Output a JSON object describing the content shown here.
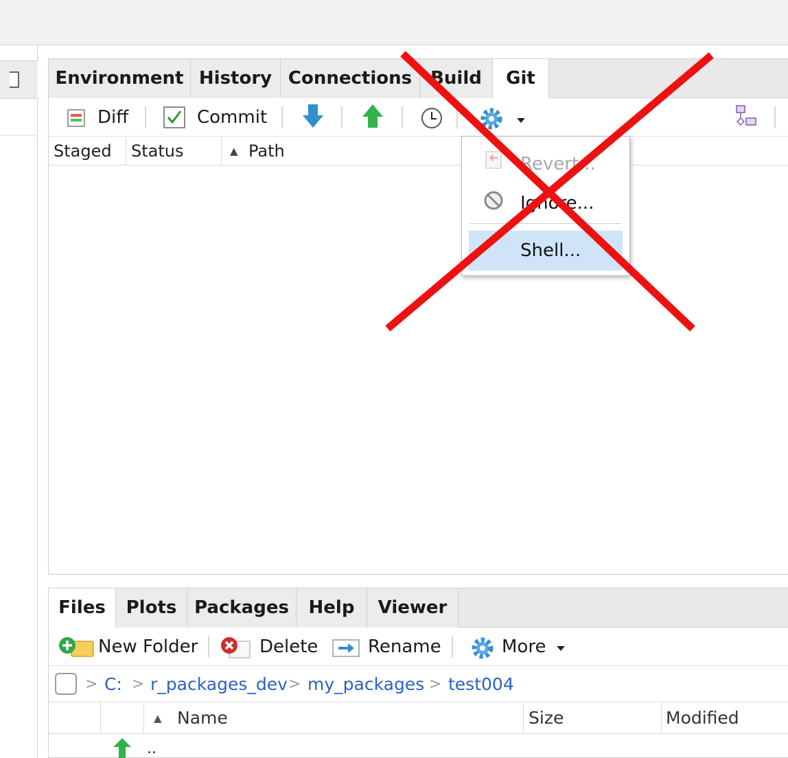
{
  "upper_pane": {
    "tabs": [
      {
        "label": "Environment",
        "active": false
      },
      {
        "label": "History",
        "active": false
      },
      {
        "label": "Connections",
        "active": false
      },
      {
        "label": "Build",
        "active": false
      },
      {
        "label": "Git",
        "active": true
      }
    ],
    "toolbar": {
      "diff_label": "Diff",
      "commit_label": "Commit",
      "icons": [
        "diff-icon",
        "commit-checkbox-icon",
        "pull-down-arrow-icon",
        "push-up-arrow-icon",
        "history-clock-icon",
        "gear-icon",
        "chevron-down-icon",
        "branch-icon"
      ]
    },
    "columns": [
      "Staged",
      "Status",
      "Path"
    ],
    "sort_indicator": "▲",
    "gear_menu": {
      "items": [
        {
          "label": "Revert...",
          "enabled": false,
          "icon": "revert-icon"
        },
        {
          "label": "Ignore...",
          "enabled": true,
          "icon": "ignore-icon"
        },
        {
          "label": "Shell...",
          "enabled": true,
          "highlighted": true
        }
      ]
    }
  },
  "lower_pane": {
    "tabs": [
      {
        "label": "Files",
        "active": true
      },
      {
        "label": "Plots",
        "active": false
      },
      {
        "label": "Packages",
        "active": false
      },
      {
        "label": "Help",
        "active": false
      },
      {
        "label": "Viewer",
        "active": false
      }
    ],
    "toolbar": {
      "new_folder_label": "New Folder",
      "delete_label": "Delete",
      "rename_label": "Rename",
      "more_label": "More"
    },
    "breadcrumb": [
      "C:",
      "r_packages_dev",
      "my_packages",
      "test004"
    ],
    "columns": [
      "Name",
      "Size",
      "Modified"
    ],
    "parent_dir_label": ".."
  },
  "overlay": {
    "type": "red-x-icon",
    "color": "#ee1111"
  },
  "colors": {
    "link": "#2a63c4",
    "menu_highlight": "#cfe5f7",
    "tab_bg": "#ececec"
  }
}
